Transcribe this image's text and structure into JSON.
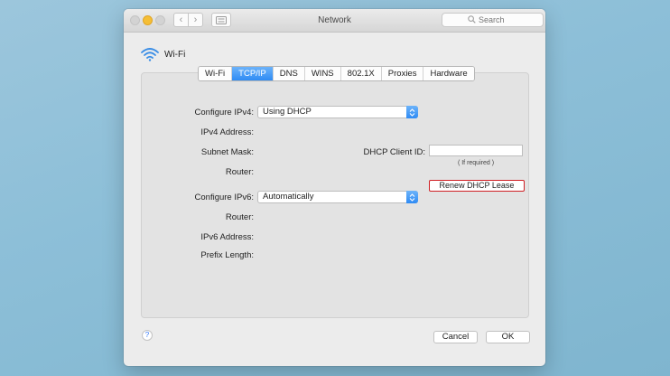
{
  "window": {
    "title": "Network"
  },
  "toolbar": {
    "search_placeholder": "Search"
  },
  "service": {
    "name": "Wi-Fi",
    "icon": "wifi-icon"
  },
  "tabs": [
    {
      "label": "Wi-Fi",
      "active": false
    },
    {
      "label": "TCP/IP",
      "active": true
    },
    {
      "label": "DNS",
      "active": false
    },
    {
      "label": "WINS",
      "active": false
    },
    {
      "label": "802.1X",
      "active": false
    },
    {
      "label": "Proxies",
      "active": false
    },
    {
      "label": "Hardware",
      "active": false
    }
  ],
  "ipv4": {
    "configure_label": "Configure IPv4:",
    "configure_value": "Using DHCP",
    "address_label": "IPv4 Address:",
    "address_value": "",
    "subnet_label": "Subnet Mask:",
    "subnet_value": "",
    "router_label": "Router:",
    "router_value": ""
  },
  "dhcp": {
    "renew_label": "Renew DHCP Lease",
    "client_id_label": "DHCP Client ID:",
    "client_id_value": "",
    "client_id_hint": "( If required )"
  },
  "ipv6": {
    "configure_label": "Configure IPv6:",
    "configure_value": "Automatically",
    "router_label": "Router:",
    "address_label": "IPv6 Address:",
    "prefix_label": "Prefix Length:"
  },
  "footer": {
    "help_label": "?",
    "cancel_label": "Cancel",
    "ok_label": "OK"
  },
  "colors": {
    "accent": "#2f8bf4",
    "highlight_border": "#cf1f24"
  }
}
